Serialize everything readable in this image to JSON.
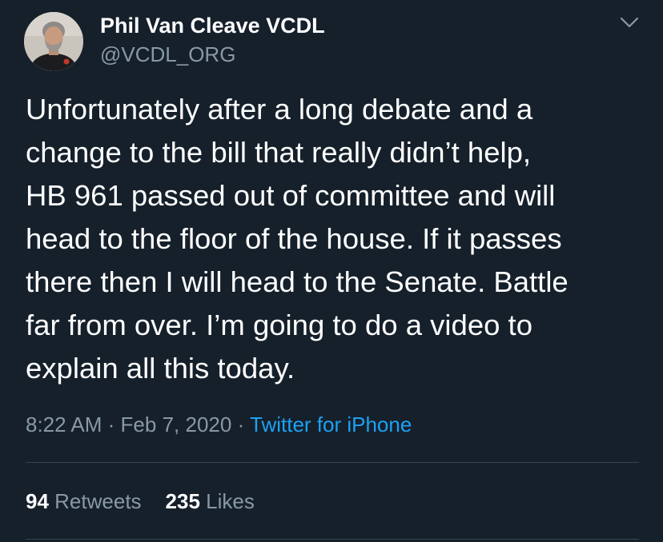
{
  "author": {
    "name": "Phil Van Cleave VCDL",
    "handle": "@VCDL_ORG"
  },
  "tweet": {
    "lines": [
      "Unfortunately after a long debate and a",
      "change to the bill that really didn’t help,",
      "HB 961 passed out of committee and will",
      "head to the floor of the house. If it passes",
      "there then I will head to the Senate.  Battle",
      "far from over. I’m going to do a video to",
      "explain all this today."
    ],
    "time": "8:22 AM",
    "date": "Feb 7, 2020",
    "separator": "·",
    "source": "Twitter for iPhone"
  },
  "stats": {
    "retweets_count": "94",
    "retweets_label": "Retweets",
    "likes_count": "235",
    "likes_label": "Likes"
  },
  "icons": {
    "caret": "chevron-down-icon",
    "avatar": "profile-photo"
  },
  "colors": {
    "background": "#15202b",
    "text": "#ffffff",
    "secondary": "#8899a6",
    "link": "#1da1f2",
    "divider": "#38444d"
  }
}
